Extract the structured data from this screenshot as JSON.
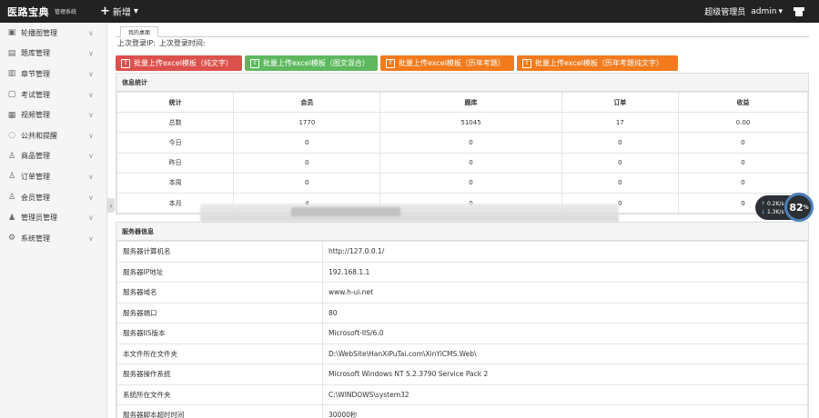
{
  "header": {
    "brand": "医路宝典",
    "brand_sub": "管理系统",
    "new_label": "新增",
    "role": "超级管理员",
    "username": "admin"
  },
  "sidebar": {
    "items": [
      {
        "label": "轮播图管理",
        "icon": "image-icon"
      },
      {
        "label": "题库管理",
        "icon": "database-icon"
      },
      {
        "label": "章节管理",
        "icon": "book-icon"
      },
      {
        "label": "考试管理",
        "icon": "exam-icon"
      },
      {
        "label": "视频管理",
        "icon": "video-icon"
      },
      {
        "label": "公共和提醒",
        "icon": "message-icon"
      },
      {
        "label": "商品管理",
        "icon": "user-icon"
      },
      {
        "label": "订单管理",
        "icon": "user-icon"
      },
      {
        "label": "会员管理",
        "icon": "user-icon"
      },
      {
        "label": "管理员管理",
        "icon": "admin-icon"
      },
      {
        "label": "系统管理",
        "icon": "gear-icon"
      }
    ]
  },
  "tabs": [
    {
      "label": "我的桌面"
    }
  ],
  "login_info": {
    "ip_label": "上次登录IP:",
    "time_label": "上次登录时间:"
  },
  "buttons": [
    {
      "label": "批量上传excel模板（纯文字）",
      "color": "#dd514c"
    },
    {
      "label": "批量上传excel模板（图文混合）",
      "color": "#5eb95e"
    },
    {
      "label": "批量上传excel模板（历年考题）",
      "color": "#f37b1d"
    },
    {
      "label": "批量上传excel模板（历年考题纯文字）",
      "color": "#f37b1d"
    }
  ],
  "stats": {
    "title": "信息统计",
    "headers": [
      "统计",
      "会员",
      "题库",
      "订单",
      "收益"
    ],
    "rows": [
      [
        "总数",
        "1770",
        "51045",
        "17",
        "0.00"
      ],
      [
        "今日",
        "0",
        "0",
        "0",
        "0"
      ],
      [
        "昨日",
        "0",
        "0",
        "0",
        "0"
      ],
      [
        "本周",
        "0",
        "0",
        "0",
        "0"
      ],
      [
        "本月",
        "4",
        "0",
        "0",
        "0"
      ]
    ]
  },
  "server": {
    "title": "服务器信息",
    "rows": [
      [
        "服务器计算机名",
        "http://127.0.0.1/"
      ],
      [
        "服务器IP地址",
        "192.168.1.1"
      ],
      [
        "服务器域名",
        "www.h-ui.net"
      ],
      [
        "服务器端口",
        "80"
      ],
      [
        "服务器IIS版本",
        "Microsoft-IIS/6.0"
      ],
      [
        "本文件所在文件夹",
        "D:\\WebSite\\HanXiPuTai.com\\XinYiCMS.Web\\"
      ],
      [
        "服务器操作系统",
        "Microsoft Windows NT 5.2.3790 Service Pack 2"
      ],
      [
        "系统所在文件夹",
        "C:\\WINDOWS\\system32"
      ],
      [
        "服务器脚本超时时间",
        "30000秒"
      ]
    ]
  },
  "net_widget": {
    "up_rate": "0.2",
    "down_rate": "1.3",
    "rate_unit": "K/s",
    "percent": "82",
    "percent_unit": "%"
  }
}
